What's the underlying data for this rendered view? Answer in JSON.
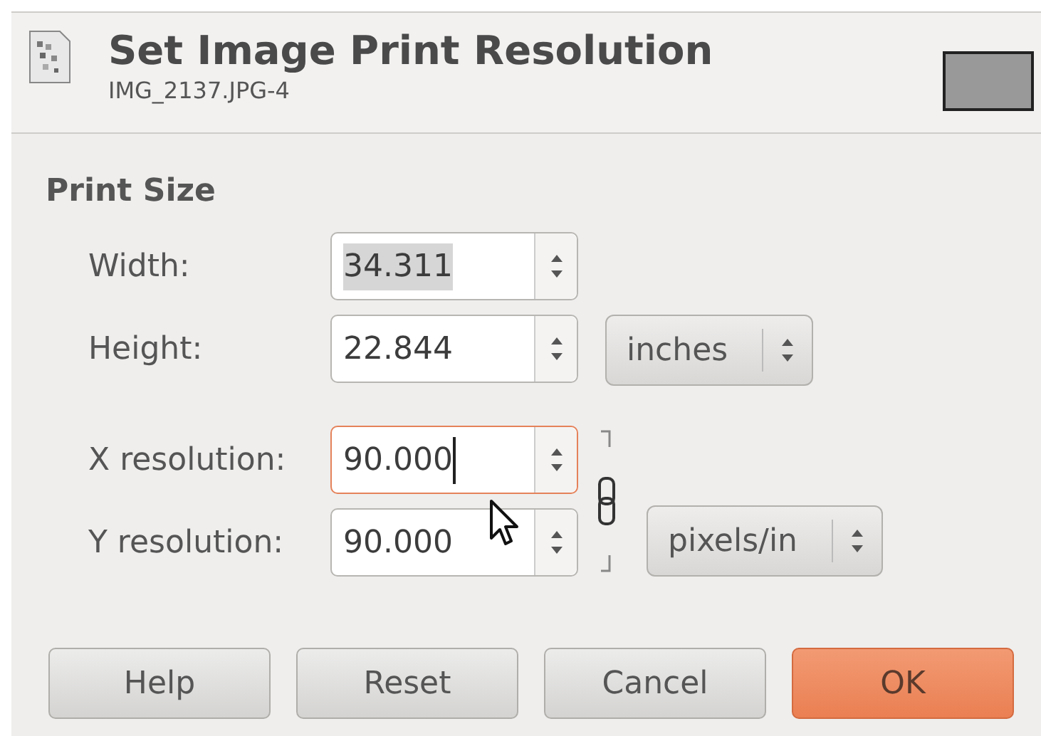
{
  "header": {
    "title": "Set Image Print Resolution",
    "subtitle": "IMG_2137.JPG-4"
  },
  "section": {
    "title": "Print Size"
  },
  "size_fields": [
    {
      "label": "Width:",
      "value": "34.311",
      "focused": false,
      "text_selected": true
    },
    {
      "label": "Height:",
      "value": "22.844",
      "focused": false,
      "text_selected": false
    }
  ],
  "size_unit": {
    "value": "inches"
  },
  "resolution_fields": [
    {
      "label": "X resolution:",
      "value": "90.000",
      "focused": true,
      "text_selected": false
    },
    {
      "label": "Y resolution:",
      "value": "90.000",
      "focused": false,
      "text_selected": false
    }
  ],
  "chained": true,
  "resolution_unit": {
    "value": "pixels/in"
  },
  "buttons": [
    {
      "label": "Help",
      "default": false
    },
    {
      "label": "Reset",
      "default": false
    },
    {
      "label": "Cancel",
      "default": false
    },
    {
      "label": "OK",
      "default": true
    }
  ]
}
